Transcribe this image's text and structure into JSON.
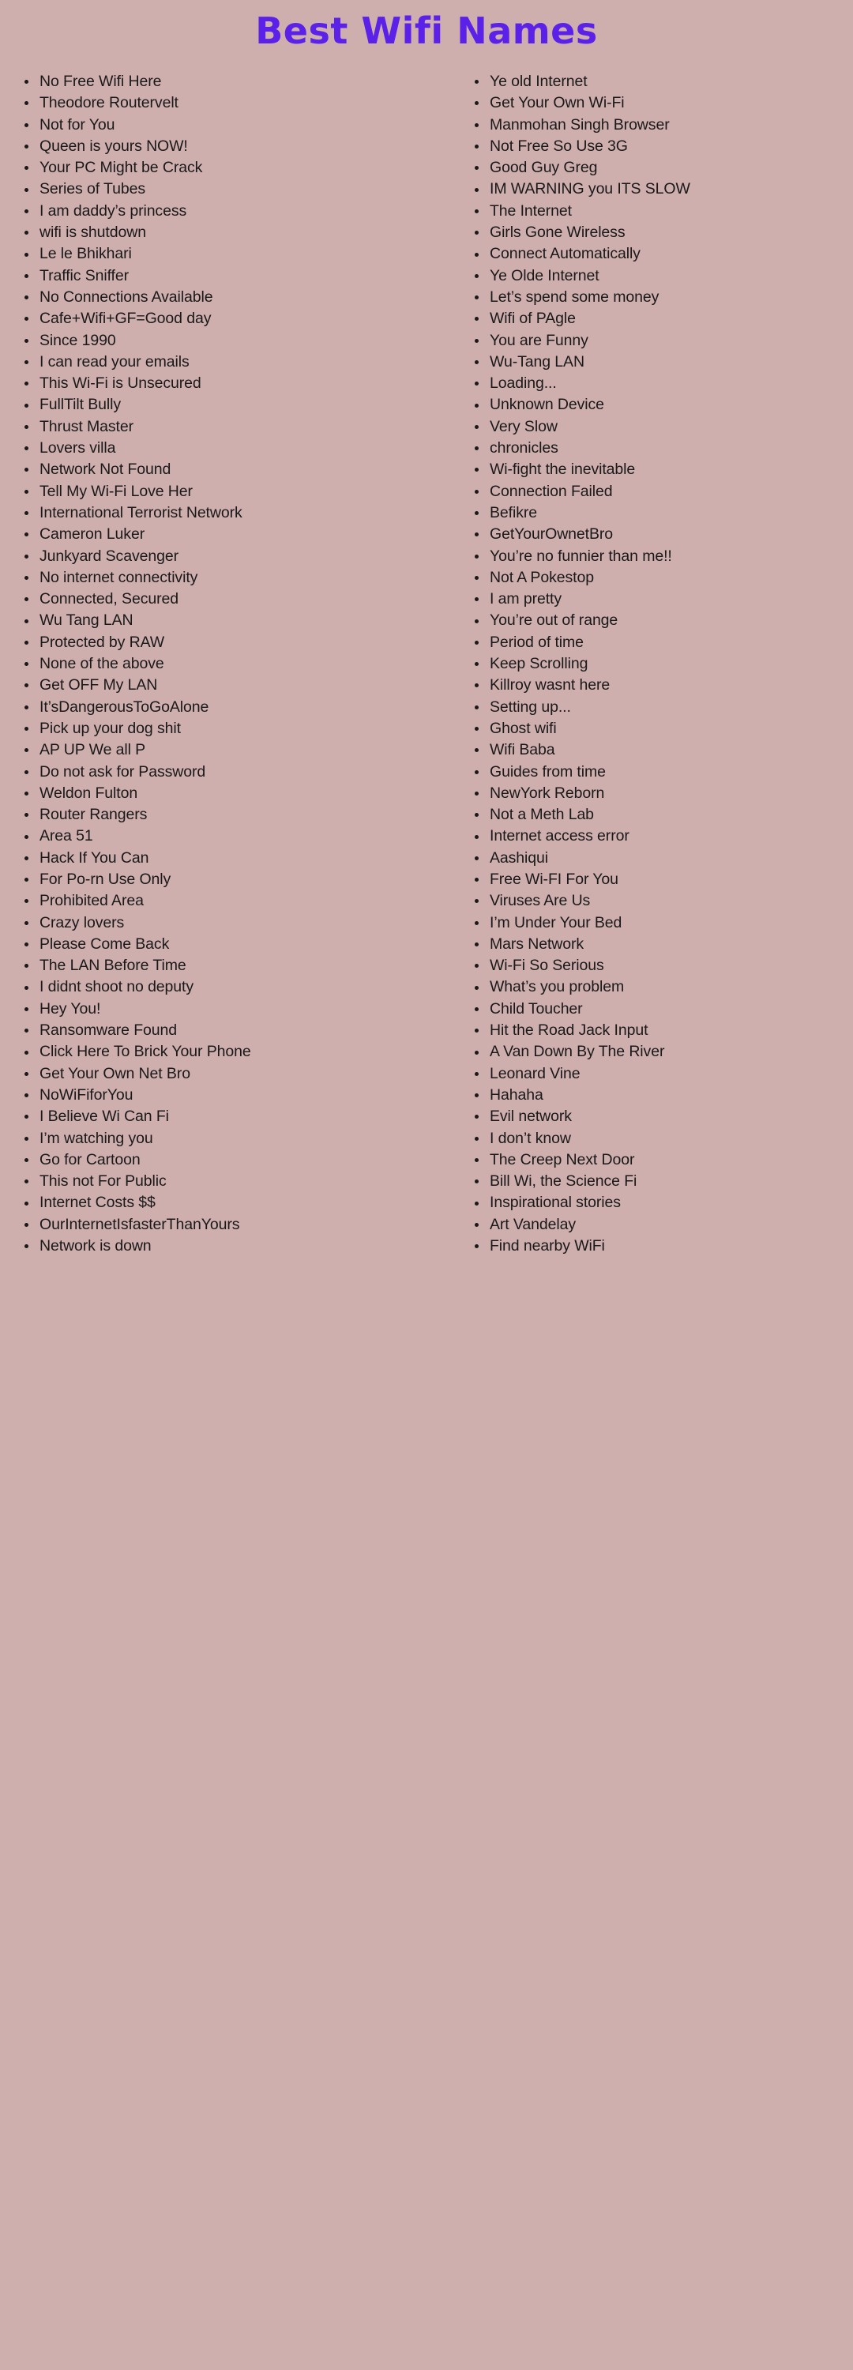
{
  "page": {
    "background_color": "#cfaeae",
    "text_color": "#191919"
  },
  "header": {
    "title": "Best Wifi Names",
    "title_color": "#5b21e8"
  },
  "columns": {
    "left": [
      "No Free Wifi Here",
      "Theodore Routervelt",
      "Not for You",
      "Queen is yours NOW!",
      "Your PC Might be Crack",
      "Series of Tubes",
      "I am daddy’s princess",
      "wifi is shutdown",
      "Le le Bhikhari",
      "Traffic Sniffer",
      "No Connections Available",
      "Cafe+Wifi+GF=Good day",
      "Since 1990",
      "I can read your emails",
      "This Wi-Fi is Unsecured",
      "FullTilt Bully",
      "Thrust Master",
      "Lovers villa",
      "Network Not Found",
      "Tell My Wi-Fi Love Her",
      "International Terrorist Network",
      "Cameron Luker",
      "Junkyard Scavenger",
      "No internet connectivity",
      "Connected, Secured",
      "Wu Tang LAN",
      "Protected by RAW",
      "None of the above",
      "Get OFF My LAN",
      "It’sDangerousToGoAlone",
      "Pick up your dog shit",
      "AP UP We all P",
      "Do not ask for Password",
      "Weldon Fulton",
      "Router Rangers",
      "Area 51",
      "Hack If You Can",
      "For Po-rn Use Only",
      "Prohibited Area",
      "Crazy lovers",
      "Please Come Back",
      "The LAN Before Time",
      "I didnt shoot no deputy",
      "Hey You!",
      "Ransomware Found",
      "Click Here To Brick Your Phone",
      "Get Your Own Net Bro",
      "NoWiFiforYou",
      "I Believe Wi Can Fi",
      "I’m watching you",
      "Go for Cartoon",
      "This not For Public",
      "Internet Costs $$",
      "OurInternetIsfasterThanYours",
      "Network is down"
    ],
    "right": [
      "Ye old Internet",
      "Get Your Own Wi-Fi",
      "Manmohan Singh Browser",
      "Not Free So Use 3G",
      "Good Guy Greg",
      "IM WARNING you ITS SLOW",
      "The Internet",
      "Girls Gone Wireless",
      "Connect Automatically",
      "Ye Olde Internet",
      "Let’s spend some money",
      "Wifi of PAgle",
      "You are Funny",
      "Wu-Tang LAN",
      "Loading...",
      "Unknown Device",
      "Very Slow",
      "chronicles",
      "Wi-fight the inevitable",
      "Connection Failed",
      "Befikre",
      "GetYourOwnetBro",
      "You’re no funnier than me!!",
      "Not A Pokestop",
      "I am pretty",
      "You’re out of range",
      "Period of time",
      "Keep Scrolling",
      "Killroy wasnt here",
      "Setting up...",
      "Ghost wifi",
      "Wifi Baba",
      "Guides from time",
      "NewYork Reborn",
      "Not a Meth Lab",
      "Internet access error",
      "Aashiqui",
      "Free Wi-FI For You",
      "Viruses Are Us",
      "I’m Under Your Bed",
      "Mars Network",
      "Wi-Fi So Serious",
      "What’s you problem",
      "Child Toucher",
      "Hit the Road Jack Input",
      "A Van Down By The River",
      "Leonard Vine",
      "Hahaha",
      "Evil network",
      "I don’t know",
      "The Creep Next Door",
      "Bill Wi, the Science Fi",
      "Inspirational stories",
      "Art Vandelay",
      "Find nearby WiFi"
    ]
  }
}
